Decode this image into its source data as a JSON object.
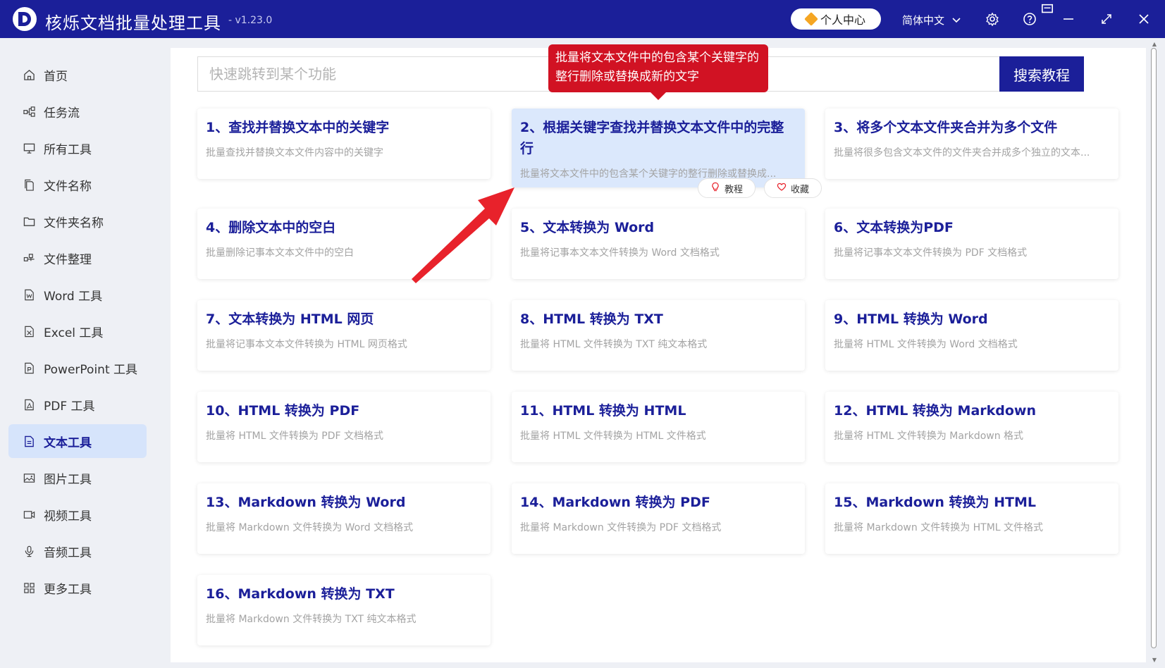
{
  "window": {
    "title": "核烁文档批量处理工具",
    "version": "- v1.23.0",
    "user_center": "个人中心",
    "language": "简体中文"
  },
  "sidebar": {
    "items": [
      {
        "label": "首页",
        "icon": "home-icon"
      },
      {
        "label": "任务流",
        "icon": "workflow-icon"
      },
      {
        "label": "所有工具",
        "icon": "monitor-icon"
      },
      {
        "label": "文件名称",
        "icon": "file-copy-icon"
      },
      {
        "label": "文件夹名称",
        "icon": "folder-icon"
      },
      {
        "label": "文件整理",
        "icon": "organize-icon"
      },
      {
        "label": "Word 工具",
        "icon": "word-file-icon"
      },
      {
        "label": "Excel 工具",
        "icon": "excel-file-icon"
      },
      {
        "label": "PowerPoint 工具",
        "icon": "ppt-file-icon"
      },
      {
        "label": "PDF 工具",
        "icon": "pdf-file-icon"
      },
      {
        "label": "文本工具",
        "icon": "text-file-icon",
        "active": true
      },
      {
        "label": "图片工具",
        "icon": "image-icon"
      },
      {
        "label": "视频工具",
        "icon": "video-icon"
      },
      {
        "label": "音频工具",
        "icon": "microphone-icon"
      },
      {
        "label": "更多工具",
        "icon": "grid-icon"
      }
    ]
  },
  "search": {
    "placeholder": "快速跳转到某个功能",
    "button": "搜索教程"
  },
  "tooltip": {
    "text": "批量将文本文件中的包含某个关键字的整行删除或替换成新的文字"
  },
  "card_actions": {
    "tutorial": "教程",
    "favorite": "收藏"
  },
  "cards": [
    {
      "title": "1、查找并替换文本中的关键字",
      "desc": "批量查找并替换文本文件内容中的关键字"
    },
    {
      "title": "2、根据关键字查找并替换文本文件中的完整行",
      "desc": "批量将文本文件中的包含某个关键字的整行删除或替换成..."
    },
    {
      "title": "3、将多个文本文件夹合并为多个文件",
      "desc": "批量将很多包含文本文件的文件夹合并成多个独立的文本..."
    },
    {
      "title": "4、删除文本中的空白",
      "desc": "批量删除记事本文本文件中的空白"
    },
    {
      "title": "5、文本转换为 Word",
      "desc": "批量将记事本文本文件转换为 Word 文档格式"
    },
    {
      "title": "6、文本转换为PDF",
      "desc": "批量将记事本文本文件转换为 PDF 文档格式"
    },
    {
      "title": "7、文本转换为 HTML 网页",
      "desc": "批量将记事本文本文件转换为 HTML 网页格式"
    },
    {
      "title": "8、HTML 转换为 TXT",
      "desc": "批量将 HTML 文件转换为 TXT 纯文本格式"
    },
    {
      "title": "9、HTML 转换为 Word",
      "desc": "批量将 HTML 文件转换为 Word 文档格式"
    },
    {
      "title": "10、HTML 转换为 PDF",
      "desc": "批量将 HTML 文件转换为 PDF 文档格式"
    },
    {
      "title": "11、HTML 转换为 HTML",
      "desc": "批量将 HTML 文件转换为 HTML 文件格式"
    },
    {
      "title": "12、HTML 转换为 Markdown",
      "desc": "批量将 HTML 文件转换为 Markdown 格式"
    },
    {
      "title": "13、Markdown 转换为 Word",
      "desc": "批量将 Markdown 文件转换为 Word 文档格式"
    },
    {
      "title": "14、Markdown 转换为 PDF",
      "desc": "批量将 Markdown 文件转换为 PDF 文档格式"
    },
    {
      "title": "15、Markdown 转换为 HTML",
      "desc": "批量将 Markdown 文件转换为 HTML 文件格式"
    },
    {
      "title": "16、Markdown 转换为 TXT",
      "desc": "批量将 Markdown 文件转换为 TXT 纯文本格式"
    }
  ],
  "colors": {
    "brand": "#1b1f99",
    "active_bg": "#d6e4fb",
    "tooltip_bg": "#d11223",
    "arrow": "#e8222b"
  }
}
